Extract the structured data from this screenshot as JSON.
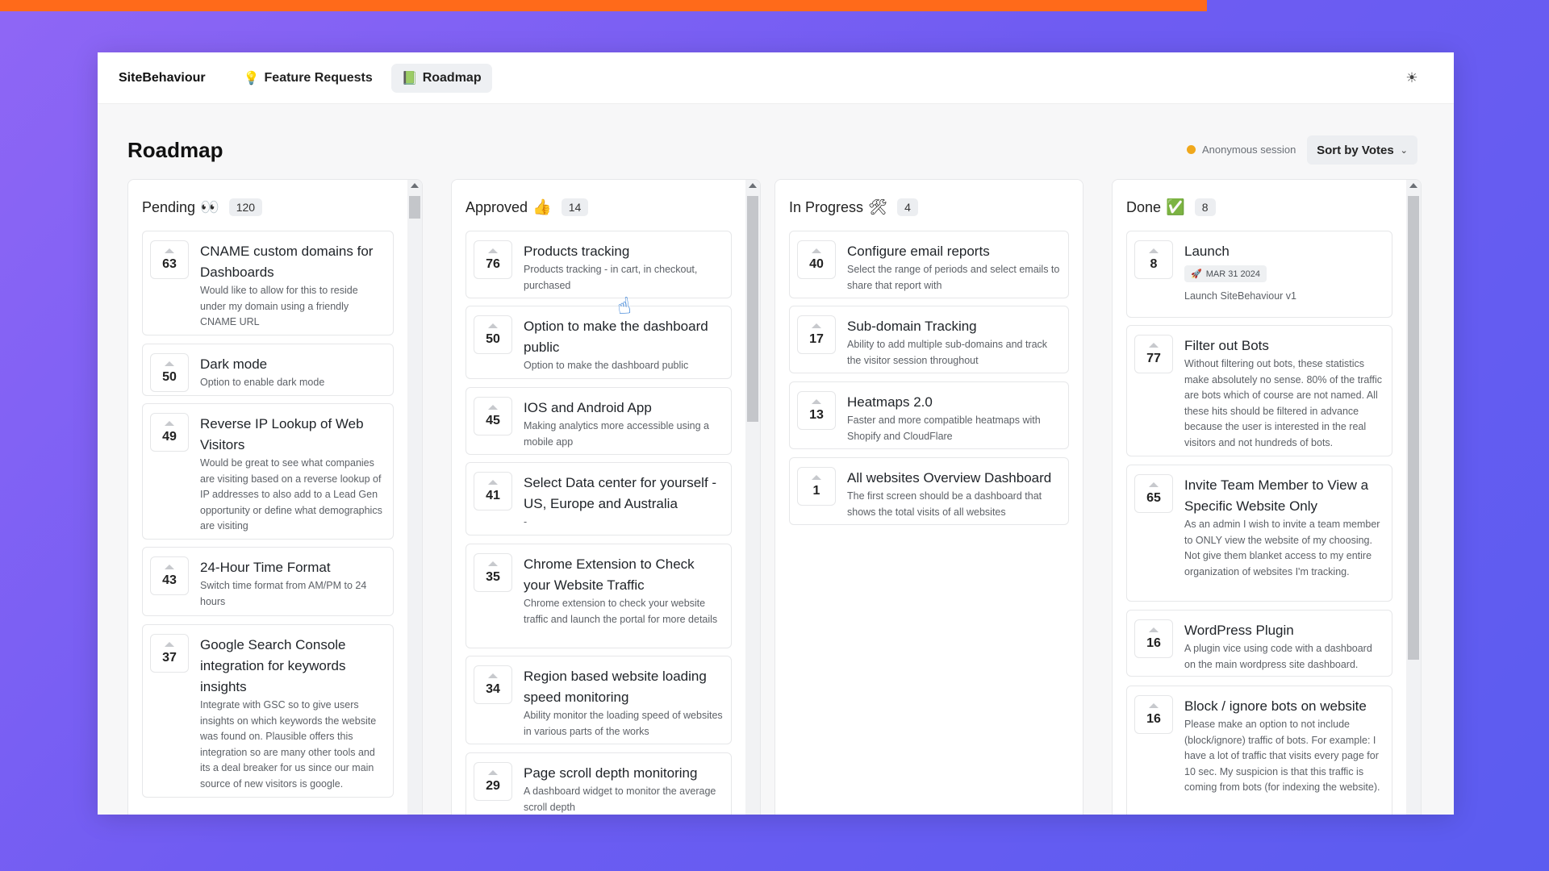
{
  "app": {
    "brand": "SiteBehaviour",
    "tabs": [
      {
        "icon": "💡",
        "label": "Feature Requests",
        "active": false
      },
      {
        "icon": "📗",
        "label": "Roadmap",
        "active": true
      }
    ],
    "theme_icon": "☀"
  },
  "page": {
    "title": "Roadmap",
    "session_label": "Anonymous session",
    "sort_label": "Sort by Votes",
    "sort_chevron": "⌄"
  },
  "columns": [
    {
      "name": "Pending",
      "icon": "👀",
      "count": "120",
      "cards": [
        {
          "votes": "63",
          "title": "CNAME custom domains for Dashboards",
          "desc": "Would like to allow for this to reside under my domain using a friendly CNAME URL"
        },
        {
          "votes": "50",
          "title": "Dark mode",
          "desc": "Option to enable dark mode"
        },
        {
          "votes": "49",
          "title": "Reverse IP Lookup of Web Visitors",
          "desc": "Would be great to see what companies are visiting based on a reverse lookup of IP addresses to also add to a Lead Gen opportunity or define what demographics are visiting"
        },
        {
          "votes": "43",
          "title": "24-Hour Time Format",
          "desc": "Switch time format from AM/PM to 24 hours"
        },
        {
          "votes": "37",
          "title": "Google Search Console integration for keywords insights",
          "desc": "Integrate with GSC so to give users insights on which keywords the website was found on. Plausible offers this integration so are many other tools and its a deal breaker for us since our main source of new visitors is google."
        }
      ]
    },
    {
      "name": "Approved",
      "icon": "👍",
      "count": "14",
      "cards": [
        {
          "votes": "76",
          "title": "Products tracking",
          "desc": "Products tracking - in cart, in checkout, purchased"
        },
        {
          "votes": "50",
          "title": "Option to make the dashboard public",
          "desc": "Option to make the dashboard public"
        },
        {
          "votes": "45",
          "title": "IOS and Android App",
          "desc": "Making analytics more accessible using a mobile app"
        },
        {
          "votes": "41",
          "title": "Select Data center for yourself - US, Europe and Australia",
          "desc": "-"
        },
        {
          "votes": "35",
          "title": "Chrome Extension to Check your Website Traffic",
          "desc": "Chrome extension to check your website traffic and launch the portal for more details"
        },
        {
          "votes": "34",
          "title": "Region based website loading speed monitoring",
          "desc": "Ability monitor the loading speed of websites in various parts of the works"
        },
        {
          "votes": "29",
          "title": "Page scroll depth monitoring",
          "desc": "A dashboard widget to monitor the average scroll depth"
        }
      ]
    },
    {
      "name": "In Progress",
      "icon": "🛠",
      "count": "4",
      "cards": [
        {
          "votes": "40",
          "title": "Configure email reports",
          "desc": "Select the range of periods and select emails to share that report with"
        },
        {
          "votes": "17",
          "title": "Sub-domain Tracking",
          "desc": "Ability to add multiple sub-domains and track the visitor session throughout"
        },
        {
          "votes": "13",
          "title": "Heatmaps 2.0",
          "desc": "Faster and more compatible heatmaps with Shopify and CloudFlare"
        },
        {
          "votes": "1",
          "title": "All websites Overview Dashboard",
          "desc": "The first screen should be a dashboard that shows the total visits of all websites"
        }
      ]
    },
    {
      "name": "Done",
      "icon": "✅",
      "count": "8",
      "cards": [
        {
          "votes": "8",
          "title": "Launch",
          "badge_icon": "🚀",
          "badge": "MAR 31 2024",
          "desc": "Launch SiteBehaviour v1"
        },
        {
          "votes": "77",
          "title": "Filter out Bots",
          "desc": "Without filtering out bots, these statistics make absolutely no sense. 80% of the traffic are bots which of course are not named. All these hits should be filtered in advance because the user is interested in the real visitors and not hundreds of bots."
        },
        {
          "votes": "65",
          "title": "Invite Team Member to View a Specific Website Only",
          "desc": "As an admin I wish to invite a team member to ONLY view the website of my choosing. Not give them blanket access to my entire organization of websites I'm tracking."
        },
        {
          "votes": "16",
          "title": "WordPress Plugin",
          "desc": "A plugin vice using code with a dashboard on the main wordpress site dashboard."
        },
        {
          "votes": "16",
          "title": "Block / ignore bots on website",
          "desc": "Please make an option to not include (block/ignore) traffic of bots. For example: I have a lot of traffic that visits every page for 10 sec. My suspicion is that this traffic is coming from bots (for indexing the website)."
        }
      ]
    }
  ]
}
